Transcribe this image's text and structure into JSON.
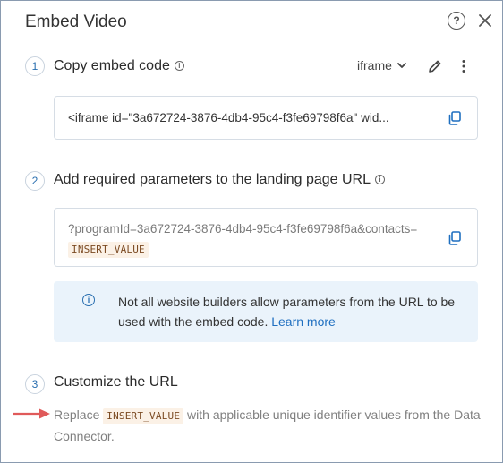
{
  "dialog": {
    "title": "Embed Video",
    "help_glyph": "?"
  },
  "step1": {
    "number": "1",
    "title": "Copy embed code",
    "info_glyph": "i",
    "format_label": "iframe",
    "code": "<iframe id=\"3a672724-3876-4db4-95c4-f3fe69798f6a\" wid..."
  },
  "step2": {
    "number": "2",
    "title": "Add required parameters to the landing page URL",
    "info_glyph": "i",
    "url_prefix": "?programId=3a672724-3876-4db4-95c4-f3fe69798f6a&contacts=",
    "url_token": "INSERT_VALUE",
    "notice_glyph": "i",
    "notice_text": "Not all website builders allow parameters from the URL to be used with the embed code. ",
    "notice_link": "Learn more"
  },
  "step3": {
    "number": "3",
    "title": "Customize the URL",
    "text_before": "Replace ",
    "token": "INSERT_VALUE",
    "text_after": " with applicable unique identifier values from the Data Connector."
  },
  "colors": {
    "accent": "#2a6fb0",
    "arrow": "#e05a5a",
    "notice_bg": "#eaf3fb",
    "token_bg": "#fbf1e6"
  }
}
